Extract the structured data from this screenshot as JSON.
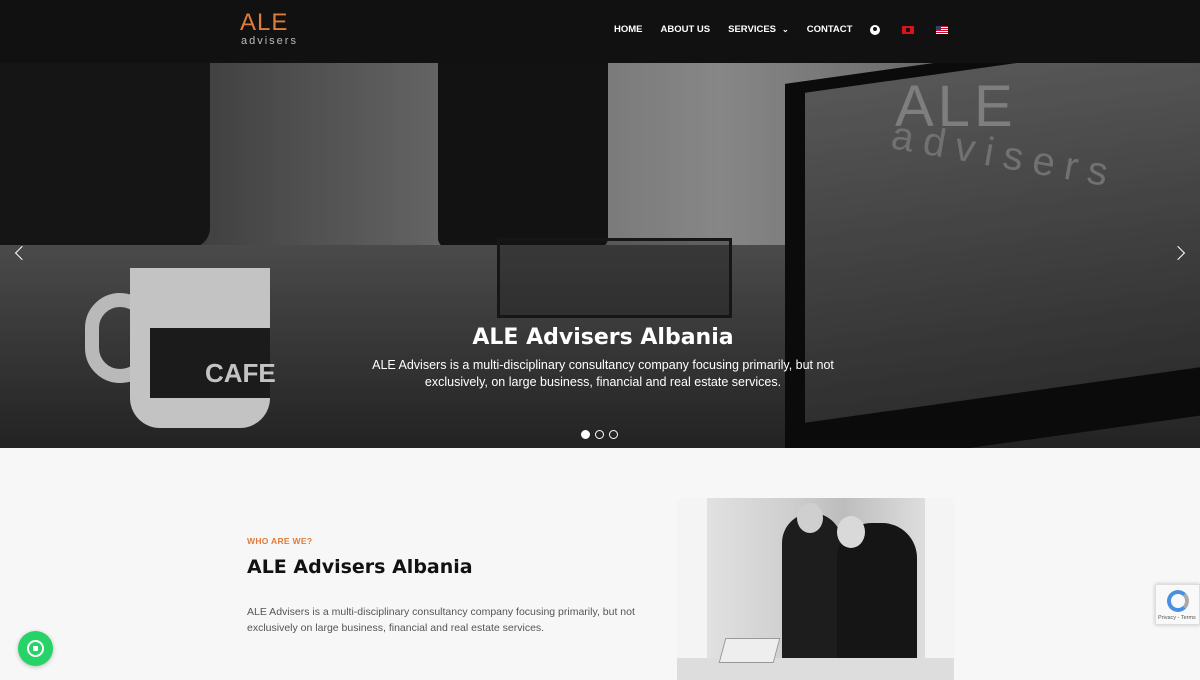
{
  "brand": {
    "logo_text": "ALE",
    "logo_sub": "advisers"
  },
  "nav": {
    "items": [
      {
        "label": "HOME"
      },
      {
        "label": "ABOUT US"
      },
      {
        "label": "SERVICES"
      },
      {
        "label": "CONTACT"
      }
    ],
    "icons": [
      "user-icon",
      "albania-flag-icon",
      "us-flag-icon"
    ]
  },
  "hero": {
    "title": "ALE Advisers Albania",
    "text": "ALE Advisers is a multi-disciplinary consultancy company focusing primarily, but not exclusively, on large business, financial and real estate services.",
    "photo_text": {
      "mug": "CAFE",
      "screen_logo": "ALE",
      "screen_sub": "advisers"
    },
    "slides_count": 3,
    "active_slide": 1
  },
  "about": {
    "kicker": "WHO ARE WE?",
    "title": "ALE Advisers Albania",
    "text": "ALE Advisers is a multi-disciplinary consultancy company focusing primarily, but not exclusively on large business, financial and real estate services."
  },
  "widgets": {
    "recaptcha_text": "Privacy - Terms"
  },
  "colors": {
    "accent": "#e07b39",
    "header_bg": "#111111",
    "whatsapp": "#25d366"
  }
}
